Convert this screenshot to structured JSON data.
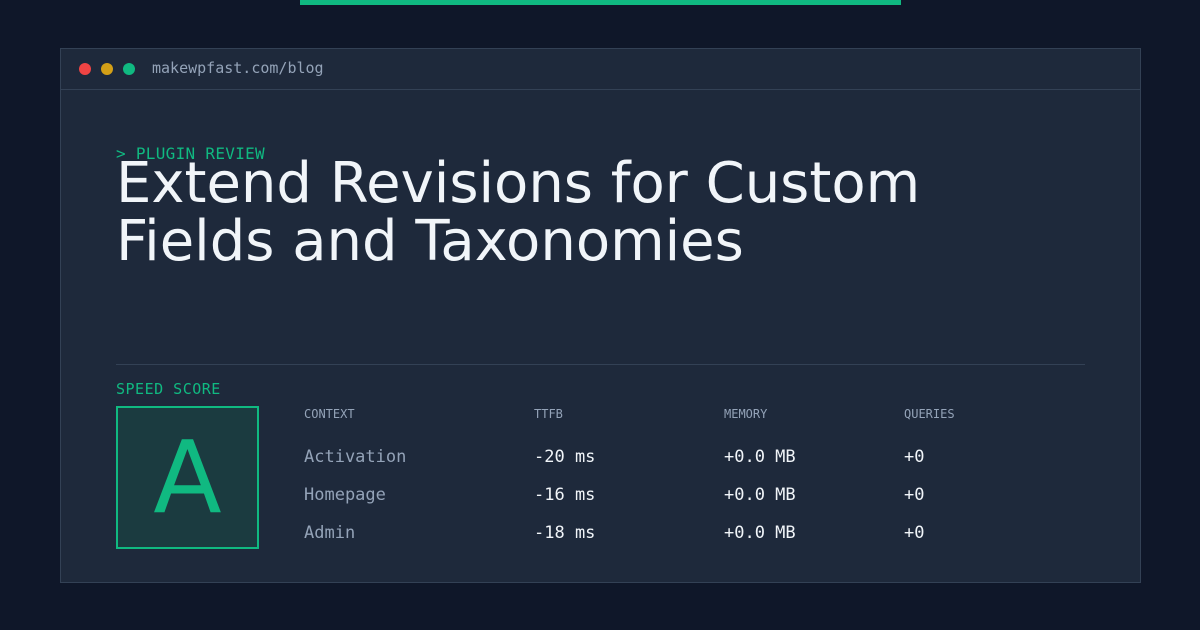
{
  "browser": {
    "url": "makewpfast.com/blog"
  },
  "post": {
    "eyebrow": "> PLUGIN REVIEW",
    "title_line_1": "Extend Revisions for Custom",
    "title_line_2": "Fields and Taxonomies"
  },
  "score": {
    "label": "SPEED SCORE",
    "grade": "A"
  },
  "metrics": {
    "headers": [
      "CONTEXT",
      "TTFB",
      "MEMORY",
      "QUERIES"
    ],
    "rows": [
      {
        "context": "Activation",
        "ttfb": "-20 ms",
        "memory": "+0.0 MB",
        "queries": "+0"
      },
      {
        "context": "Homepage",
        "ttfb": "-16 ms",
        "memory": "+0.0 MB",
        "queries": "+0"
      },
      {
        "context": "Admin",
        "ttfb": "-18 ms",
        "memory": "+0.0 MB",
        "queries": "+0"
      }
    ]
  },
  "colors": {
    "background": "#0f1729",
    "panel": "#1e293b",
    "accent": "#10b981",
    "text": "#f1f5f9",
    "muted": "#94a3b8"
  }
}
